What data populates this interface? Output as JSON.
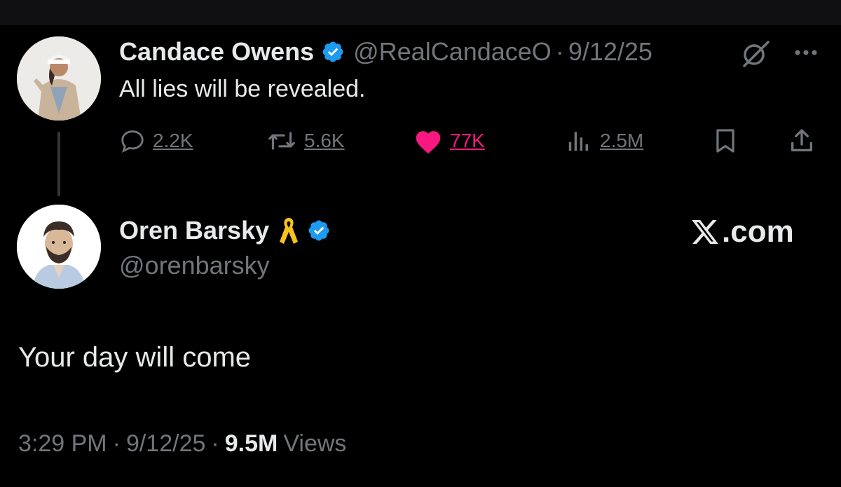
{
  "parent_tweet": {
    "author_name": "Candace Owens",
    "handle": "@RealCandaceO",
    "date": "9/12/25",
    "separator": "·",
    "text": "All lies will be revealed.",
    "avatar": "profile-photo",
    "verified_icon": "verified-badge-icon",
    "actions": {
      "replies": "2.2K",
      "reposts": "5.6K",
      "likes": "77K",
      "views": "2.5M"
    },
    "liked": true
  },
  "reply_tweet": {
    "author_name": "Oren Barsky",
    "handle": "@orenbarsky",
    "text": "Your day will come",
    "ribbon_icon": "yellow-ribbon-icon",
    "verified_icon": "verified-badge-icon",
    "watermark": ".com",
    "time": "3:29 PM",
    "date": "9/12/25",
    "separator": "·",
    "views_count": "9.5M",
    "views_label": "Views"
  },
  "colors": {
    "background": "#000000",
    "text": "#e7e9ea",
    "muted": "#71767b",
    "like": "#f91880",
    "verified": "#1d9bf0",
    "ribbon": "#f7c21b"
  }
}
